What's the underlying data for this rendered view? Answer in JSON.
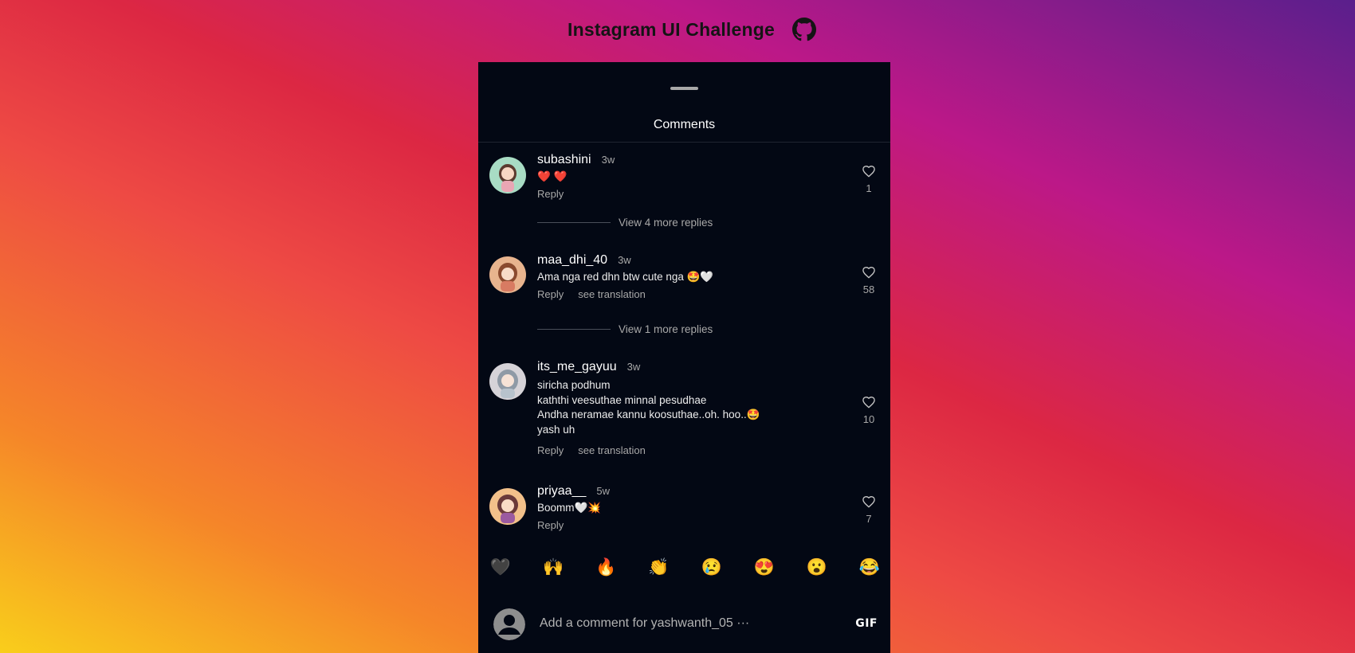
{
  "page": {
    "title": "Instagram UI Challenge"
  },
  "sheet": {
    "title": "Comments"
  },
  "comments": [
    {
      "username": "subashini",
      "time": "3w",
      "text": "❤️ ❤️",
      "reply": "Reply",
      "likes": "1",
      "view_replies": "View 4 more replies"
    },
    {
      "username": "maa_dhi_40",
      "time": "3w",
      "text": "Ama nga red dhn btw cute nga 🤩🤍",
      "reply": "Reply",
      "translate": "see translation",
      "likes": "58",
      "view_replies": "View 1 more replies"
    },
    {
      "username": "its_me_gayuu",
      "time": "3w",
      "text": "siricha podhum\nkaththi veesuthae minnal pesudhae\nAndha neramae kannu koosuthae..oh. hoo..🤩\nyash uh",
      "reply": "Reply",
      "translate": "see translation",
      "likes": "10"
    },
    {
      "username": "priyaa__",
      "time": "5w",
      "text": "Boomm🤍💥",
      "reply": "Reply",
      "likes": "7"
    }
  ],
  "emoji_bar": [
    "🖤",
    "🙌",
    "🔥",
    "👏",
    "😢",
    "😍",
    "😮",
    "😂"
  ],
  "composer": {
    "placeholder": "Add a comment for yashwanth_05 ···",
    "gif_label": "GIF"
  },
  "colors": {
    "sheet_bg": "#030814",
    "muted": "#a8a8a8"
  },
  "icons": {
    "github": "github-icon",
    "like": "heart-outline-icon",
    "me": "default-avatar-icon"
  }
}
